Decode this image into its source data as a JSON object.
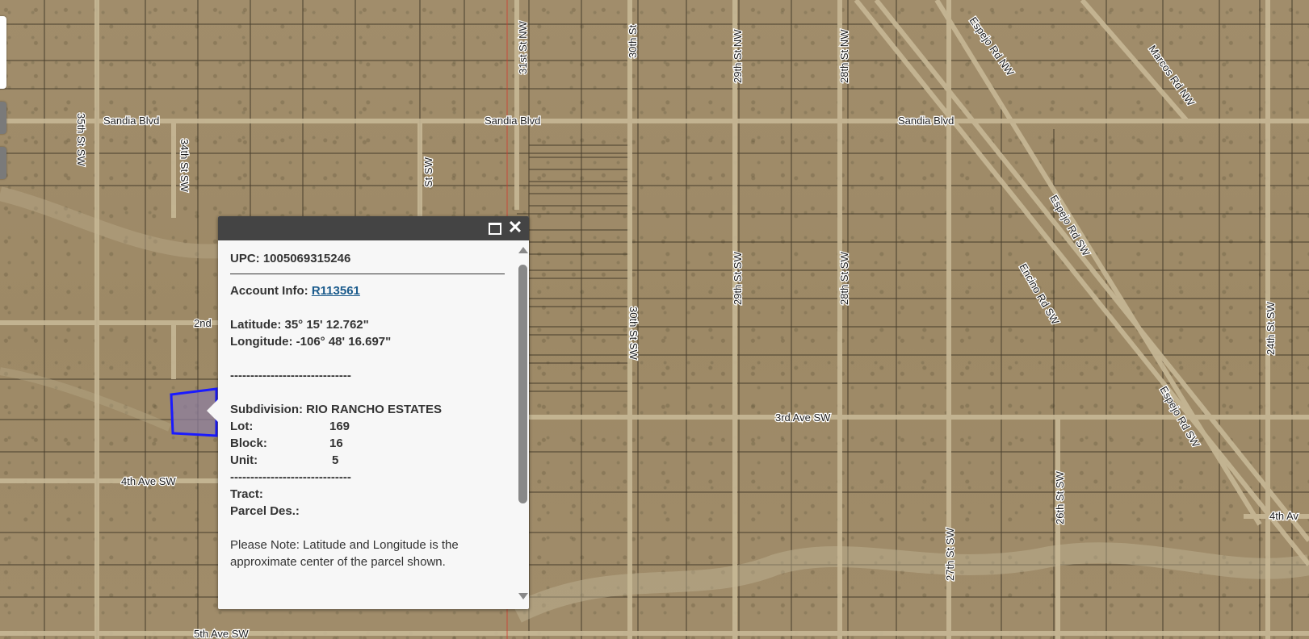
{
  "map": {
    "roads_horizontal": [
      "Sandia Blvd",
      "Sandia Blvd",
      "Sandia Blvd",
      "2nd",
      "3rd Ave SW",
      "4th Ave SW",
      "4th Av",
      "5th Ave SW"
    ],
    "roads_vertical": [
      "35th St SW",
      "34th St SW",
      "31st St NW",
      "30th St",
      "29th St NW",
      "28th St NW",
      "30th St SW",
      "29th St SW",
      "28th St SW",
      "27th St SW",
      "26th St SW",
      "24th St SW",
      "St SW"
    ],
    "roads_diagonal": [
      "Espejo Rd NW",
      "Marcos Rd NW",
      "Espejo Rd SW",
      "Encino Rd SW",
      "Espejo Rd SW"
    ],
    "selected_parcel_color": "#1a1aff"
  },
  "popup": {
    "upc": "UPC: 1005069315246",
    "account_label": "Account Info: ",
    "account_link": "R113561",
    "latitude": "Latitude: 35° 15' 12.762\"",
    "longitude": "Longitude: -106° 48' 16.697\"",
    "separator": "------------------------------",
    "subdivision": "Subdivision: RIO RANCHO ESTATES",
    "lot_label": "Lot:",
    "lot_value": "169",
    "block_label": "Block:",
    "block_value": "16",
    "unit_label": "Unit:",
    "unit_value": "5",
    "tract_label": "Tract:",
    "parcel_des_label": "Parcel Des.:",
    "note": "Please Note: Latitude and Longitude is the approximate center of the parcel shown."
  },
  "icons": {
    "maximize": "maximize-icon",
    "close": "close-icon",
    "scroll_up": "scroll-up-icon",
    "scroll_down": "scroll-down-icon"
  }
}
